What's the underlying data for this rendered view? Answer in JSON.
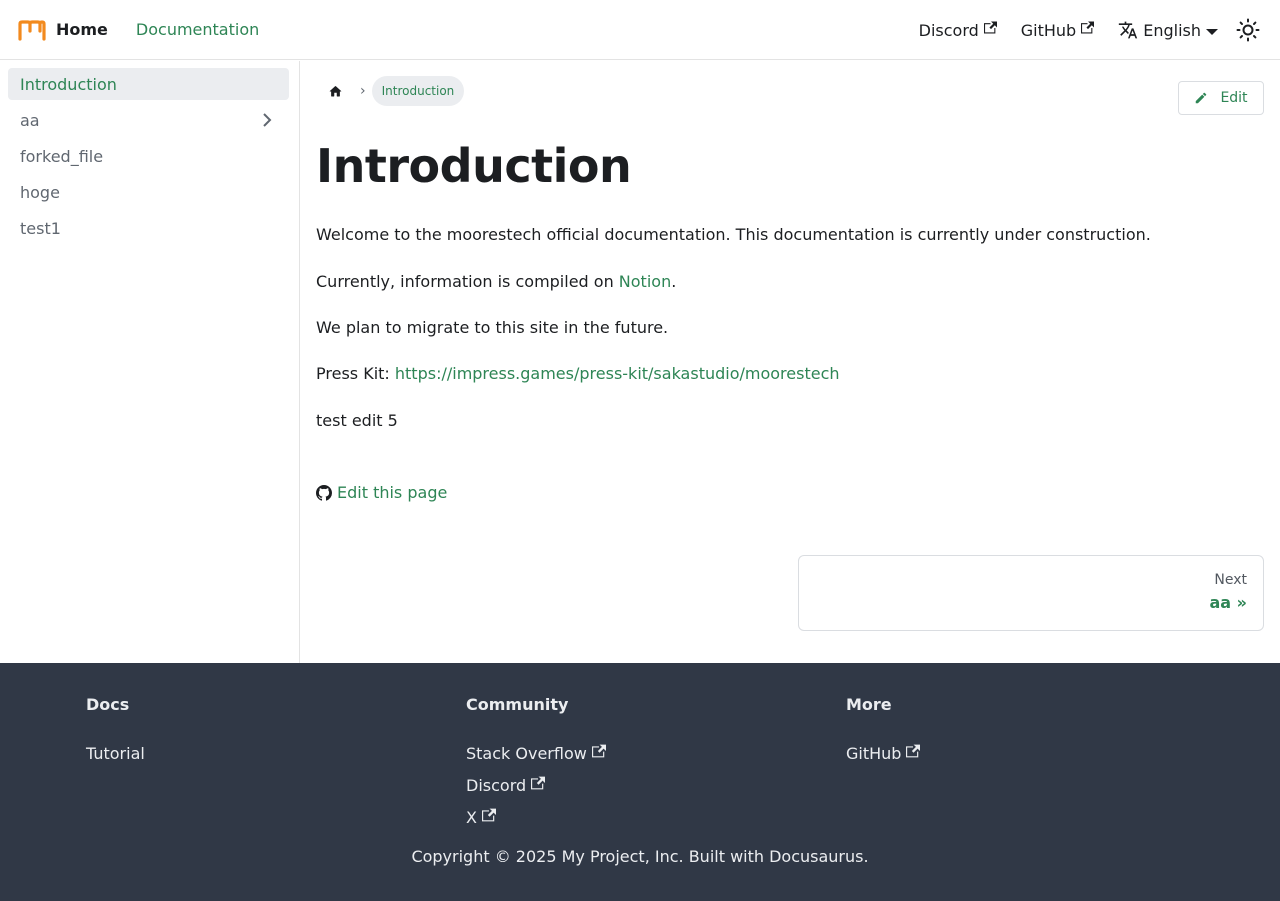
{
  "navbar": {
    "brand_title": "Home",
    "doc_link": "Documentation",
    "discord": "Discord",
    "github": "GitHub",
    "language": "English"
  },
  "sidebar": {
    "items": [
      {
        "label": "Introduction",
        "active": true
      },
      {
        "label": "aa",
        "expandable": true
      },
      {
        "label": "forked_file"
      },
      {
        "label": "hoge"
      },
      {
        "label": "test1"
      }
    ]
  },
  "main": {
    "breadcrumb_current": "Introduction",
    "edit_button": "Edit",
    "title": "Introduction",
    "p1": "Welcome to the moorestech official documentation. This documentation is currently under construction.",
    "p2_prefix": "Currently, information is compiled on ",
    "p2_link": "Notion",
    "p2_suffix": ".",
    "p3": "We plan to migrate to this site in the future.",
    "p4_prefix": "Press Kit: ",
    "p4_link": "https://impress.games/press-kit/sakastudio/moorestech",
    "p5": "test edit 5",
    "edit_page": "Edit this page",
    "next_sub": "Next",
    "next_label": "aa »"
  },
  "footer": {
    "col1_title": "Docs",
    "col1_links": [
      "Tutorial"
    ],
    "col2_title": "Community",
    "col2_links": [
      "Stack Overflow",
      "Discord",
      "X"
    ],
    "col3_title": "More",
    "col3_links": [
      "GitHub"
    ],
    "copyright": "Copyright © 2025 My Project, Inc. Built with Docusaurus."
  },
  "colors": {
    "accent": "#2e8555",
    "logo": "#f28a1e",
    "footer_bg": "#303846"
  }
}
